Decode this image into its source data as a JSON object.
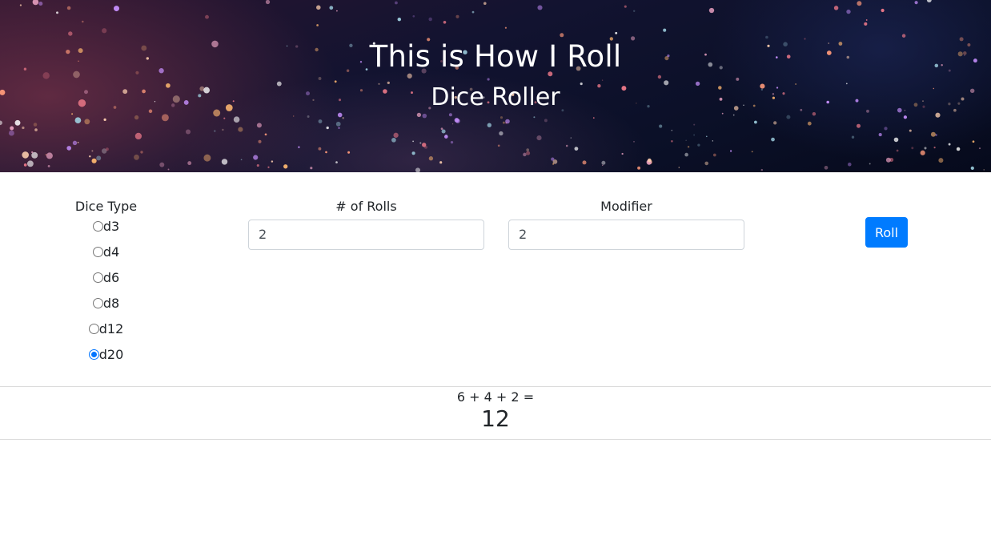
{
  "header": {
    "title": "This is How I Roll",
    "subtitle": "Dice Roller"
  },
  "form": {
    "dice_type": {
      "label": "Dice Type",
      "options": [
        "d3",
        "d4",
        "d6",
        "d8",
        "d12",
        "d20"
      ],
      "selected": "d20"
    },
    "rolls": {
      "label": "# of Rolls",
      "value": "2"
    },
    "modifier": {
      "label": "Modifier",
      "value": "2"
    },
    "roll_button": "Roll"
  },
  "result": {
    "equation": "6 + 4 + 2 =",
    "total": "12"
  },
  "colors": {
    "accent": "#007bff",
    "radio_checked": "#0075ff"
  }
}
